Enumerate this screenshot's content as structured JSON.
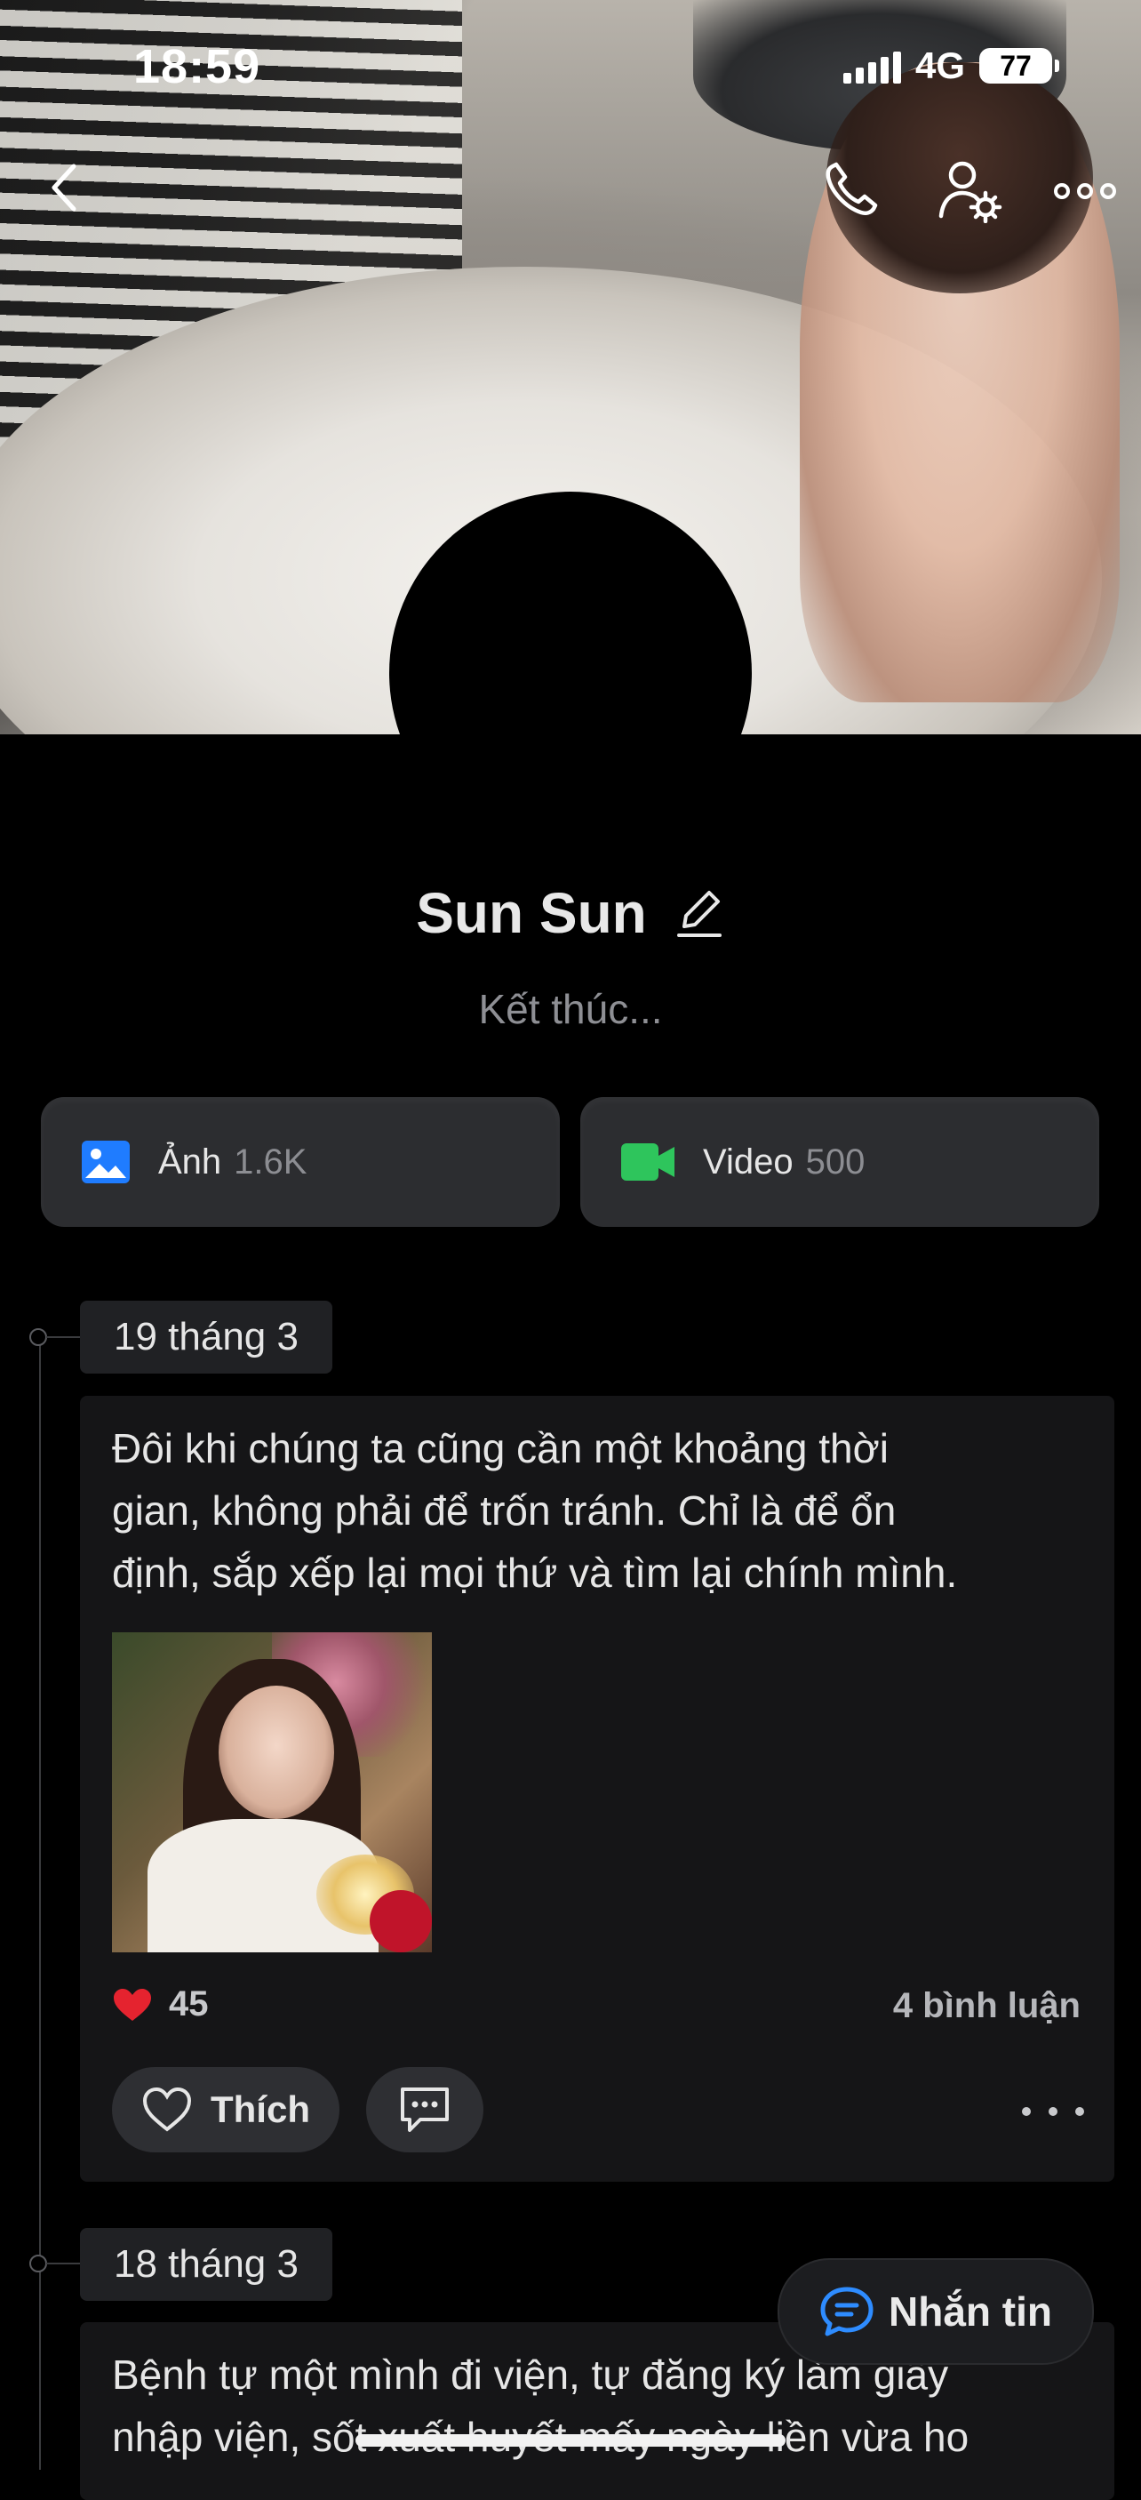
{
  "status_bar": {
    "time": "18:59",
    "network": "4G",
    "battery": "77"
  },
  "profile": {
    "name": "Sun Sun",
    "bio": "Kết thúc..."
  },
  "media": {
    "photos_label": "Ảnh",
    "photos_count": "1.6K",
    "videos_label": "Video",
    "videos_count": "500"
  },
  "posts": [
    {
      "date": "19 tháng 3",
      "text_lines": [
        "Đôi khi chúng ta cũng cần một khoảng thời",
        "gian, không phải để trốn tránh. Chỉ là để ổn",
        "định, sắp xếp lại mọi thứ và tìm lại chính mình."
      ],
      "likes": "45",
      "comments": "4 bình luận",
      "like_label": "Thích"
    },
    {
      "date": "18 tháng 3",
      "text_lines": [
        "Bệnh tự một mình đi viện, tự đăng ký làm giây",
        "nhập viện, sốt xuất huyết mấy ngày liền vừa ho"
      ]
    }
  ],
  "message_button": {
    "label": "Nhắn tin"
  },
  "icons": {
    "back": "back-icon",
    "call": "phone-icon",
    "friend_settings": "user-settings-icon",
    "more": "more-icon",
    "edit": "pencil-icon",
    "photo": "photo-icon",
    "video": "video-icon",
    "heart": "heart-icon",
    "comment": "comment-icon",
    "chat": "chat-icon"
  },
  "colors": {
    "background": "#000000",
    "card": "#151517",
    "photo_icon": "#1f7cff",
    "video_icon": "#2ec55c",
    "message_icon": "#2e8cff",
    "heart": "#e5232f"
  }
}
